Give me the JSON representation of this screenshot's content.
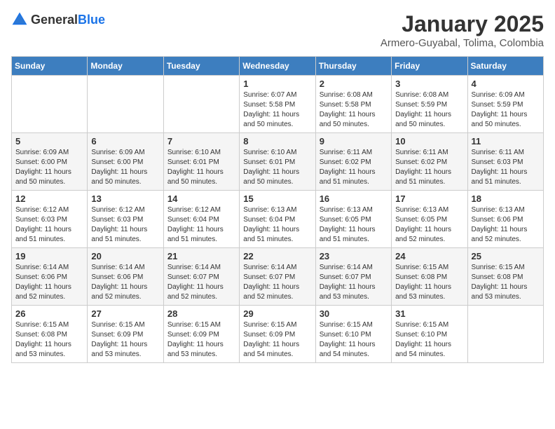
{
  "header": {
    "logo_general": "General",
    "logo_blue": "Blue",
    "month_title": "January 2025",
    "location": "Armero-Guyabal, Tolima, Colombia"
  },
  "days_of_week": [
    "Sunday",
    "Monday",
    "Tuesday",
    "Wednesday",
    "Thursday",
    "Friday",
    "Saturday"
  ],
  "weeks": [
    [
      {
        "day": "",
        "info": ""
      },
      {
        "day": "",
        "info": ""
      },
      {
        "day": "",
        "info": ""
      },
      {
        "day": "1",
        "info": "Sunrise: 6:07 AM\nSunset: 5:58 PM\nDaylight: 11 hours and 50 minutes."
      },
      {
        "day": "2",
        "info": "Sunrise: 6:08 AM\nSunset: 5:58 PM\nDaylight: 11 hours and 50 minutes."
      },
      {
        "day": "3",
        "info": "Sunrise: 6:08 AM\nSunset: 5:59 PM\nDaylight: 11 hours and 50 minutes."
      },
      {
        "day": "4",
        "info": "Sunrise: 6:09 AM\nSunset: 5:59 PM\nDaylight: 11 hours and 50 minutes."
      }
    ],
    [
      {
        "day": "5",
        "info": "Sunrise: 6:09 AM\nSunset: 6:00 PM\nDaylight: 11 hours and 50 minutes."
      },
      {
        "day": "6",
        "info": "Sunrise: 6:09 AM\nSunset: 6:00 PM\nDaylight: 11 hours and 50 minutes."
      },
      {
        "day": "7",
        "info": "Sunrise: 6:10 AM\nSunset: 6:01 PM\nDaylight: 11 hours and 50 minutes."
      },
      {
        "day": "8",
        "info": "Sunrise: 6:10 AM\nSunset: 6:01 PM\nDaylight: 11 hours and 50 minutes."
      },
      {
        "day": "9",
        "info": "Sunrise: 6:11 AM\nSunset: 6:02 PM\nDaylight: 11 hours and 51 minutes."
      },
      {
        "day": "10",
        "info": "Sunrise: 6:11 AM\nSunset: 6:02 PM\nDaylight: 11 hours and 51 minutes."
      },
      {
        "day": "11",
        "info": "Sunrise: 6:11 AM\nSunset: 6:03 PM\nDaylight: 11 hours and 51 minutes."
      }
    ],
    [
      {
        "day": "12",
        "info": "Sunrise: 6:12 AM\nSunset: 6:03 PM\nDaylight: 11 hours and 51 minutes."
      },
      {
        "day": "13",
        "info": "Sunrise: 6:12 AM\nSunset: 6:03 PM\nDaylight: 11 hours and 51 minutes."
      },
      {
        "day": "14",
        "info": "Sunrise: 6:12 AM\nSunset: 6:04 PM\nDaylight: 11 hours and 51 minutes."
      },
      {
        "day": "15",
        "info": "Sunrise: 6:13 AM\nSunset: 6:04 PM\nDaylight: 11 hours and 51 minutes."
      },
      {
        "day": "16",
        "info": "Sunrise: 6:13 AM\nSunset: 6:05 PM\nDaylight: 11 hours and 51 minutes."
      },
      {
        "day": "17",
        "info": "Sunrise: 6:13 AM\nSunset: 6:05 PM\nDaylight: 11 hours and 52 minutes."
      },
      {
        "day": "18",
        "info": "Sunrise: 6:13 AM\nSunset: 6:06 PM\nDaylight: 11 hours and 52 minutes."
      }
    ],
    [
      {
        "day": "19",
        "info": "Sunrise: 6:14 AM\nSunset: 6:06 PM\nDaylight: 11 hours and 52 minutes."
      },
      {
        "day": "20",
        "info": "Sunrise: 6:14 AM\nSunset: 6:06 PM\nDaylight: 11 hours and 52 minutes."
      },
      {
        "day": "21",
        "info": "Sunrise: 6:14 AM\nSunset: 6:07 PM\nDaylight: 11 hours and 52 minutes."
      },
      {
        "day": "22",
        "info": "Sunrise: 6:14 AM\nSunset: 6:07 PM\nDaylight: 11 hours and 52 minutes."
      },
      {
        "day": "23",
        "info": "Sunrise: 6:14 AM\nSunset: 6:07 PM\nDaylight: 11 hours and 53 minutes."
      },
      {
        "day": "24",
        "info": "Sunrise: 6:15 AM\nSunset: 6:08 PM\nDaylight: 11 hours and 53 minutes."
      },
      {
        "day": "25",
        "info": "Sunrise: 6:15 AM\nSunset: 6:08 PM\nDaylight: 11 hours and 53 minutes."
      }
    ],
    [
      {
        "day": "26",
        "info": "Sunrise: 6:15 AM\nSunset: 6:08 PM\nDaylight: 11 hours and 53 minutes."
      },
      {
        "day": "27",
        "info": "Sunrise: 6:15 AM\nSunset: 6:09 PM\nDaylight: 11 hours and 53 minutes."
      },
      {
        "day": "28",
        "info": "Sunrise: 6:15 AM\nSunset: 6:09 PM\nDaylight: 11 hours and 53 minutes."
      },
      {
        "day": "29",
        "info": "Sunrise: 6:15 AM\nSunset: 6:09 PM\nDaylight: 11 hours and 54 minutes."
      },
      {
        "day": "30",
        "info": "Sunrise: 6:15 AM\nSunset: 6:10 PM\nDaylight: 11 hours and 54 minutes."
      },
      {
        "day": "31",
        "info": "Sunrise: 6:15 AM\nSunset: 6:10 PM\nDaylight: 11 hours and 54 minutes."
      },
      {
        "day": "",
        "info": ""
      }
    ]
  ]
}
